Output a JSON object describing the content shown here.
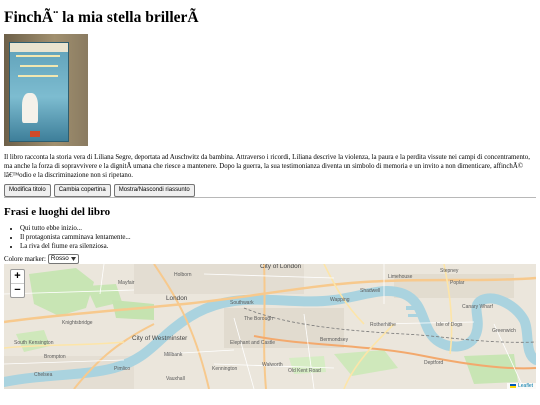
{
  "page": {
    "title": "FinchÃ¨ la mia stella brillerÃ ",
    "summary": "Il libro racconta la storia vera di Liliana Segre, deportata ad Auschwitz da bambina. Attraverso i ricordi, Liliana descrive la violenza, la paura e la perdita vissute nei campi di concentramento, ma anche la forza di sopravvivere e la dignitÃ  umana che riesce a mantenere. Dopo la guerra, la sua testimonianza diventa un simbolo di memoria e un invito a non dimenticare, affinchÃ© lâ€™odio e la discriminazione non si ripetano."
  },
  "cover": {
    "author": "Liliana Segre",
    "title": "Finché la mia stella brillerà"
  },
  "buttons": {
    "edit_title": "Modifica titolo",
    "change_cover": "Cambia copertina",
    "toggle_summary": "Mostra/Nascondi riassunto"
  },
  "section": {
    "heading": "Frasi e luoghi del libro",
    "phrases": [
      "Qui tutto ebbe inizio...",
      "Il protagonista camminava lentamente...",
      "La riva del fiume era silenziosa."
    ]
  },
  "marker": {
    "label": "Colore marker:",
    "selected": "Rosso"
  },
  "map": {
    "zoom_in": "+",
    "zoom_out": "−",
    "attribution": "Leaflet",
    "labels": {
      "city_of_london": "City of London",
      "london": "London",
      "city_of_westminster": "City of Westminster",
      "southwark": "Southwark",
      "the_borough": "The Borough",
      "bermondsey": "Bermondsey",
      "rotherhithe": "Rotherhithe",
      "wapping": "Wapping",
      "shadwell": "Shadwell",
      "poplar": "Poplar",
      "isle_of_dogs": "Isle of Dogs",
      "greenwich": "Greenwich",
      "kennington": "Kennington",
      "walworth": "Walworth",
      "old_kent_road": "Old Kent Road",
      "elephant_and_castle": "Elephant and Castle",
      "mayfair": "Mayfair",
      "knightsbridge": "Knightsbridge",
      "south_kensington": "South Kensington",
      "brompton": "Brompton",
      "chelsea": "Chelsea",
      "pimlico": "Pimlico",
      "millbank": "Millbank",
      "vauxhall": "Vauxhall",
      "canary_wharf": "Canary Wharf",
      "deptford": "Deptford",
      "limehouse": "Limehouse",
      "stepney": "Stepney",
      "holborn": "Holborn"
    }
  }
}
